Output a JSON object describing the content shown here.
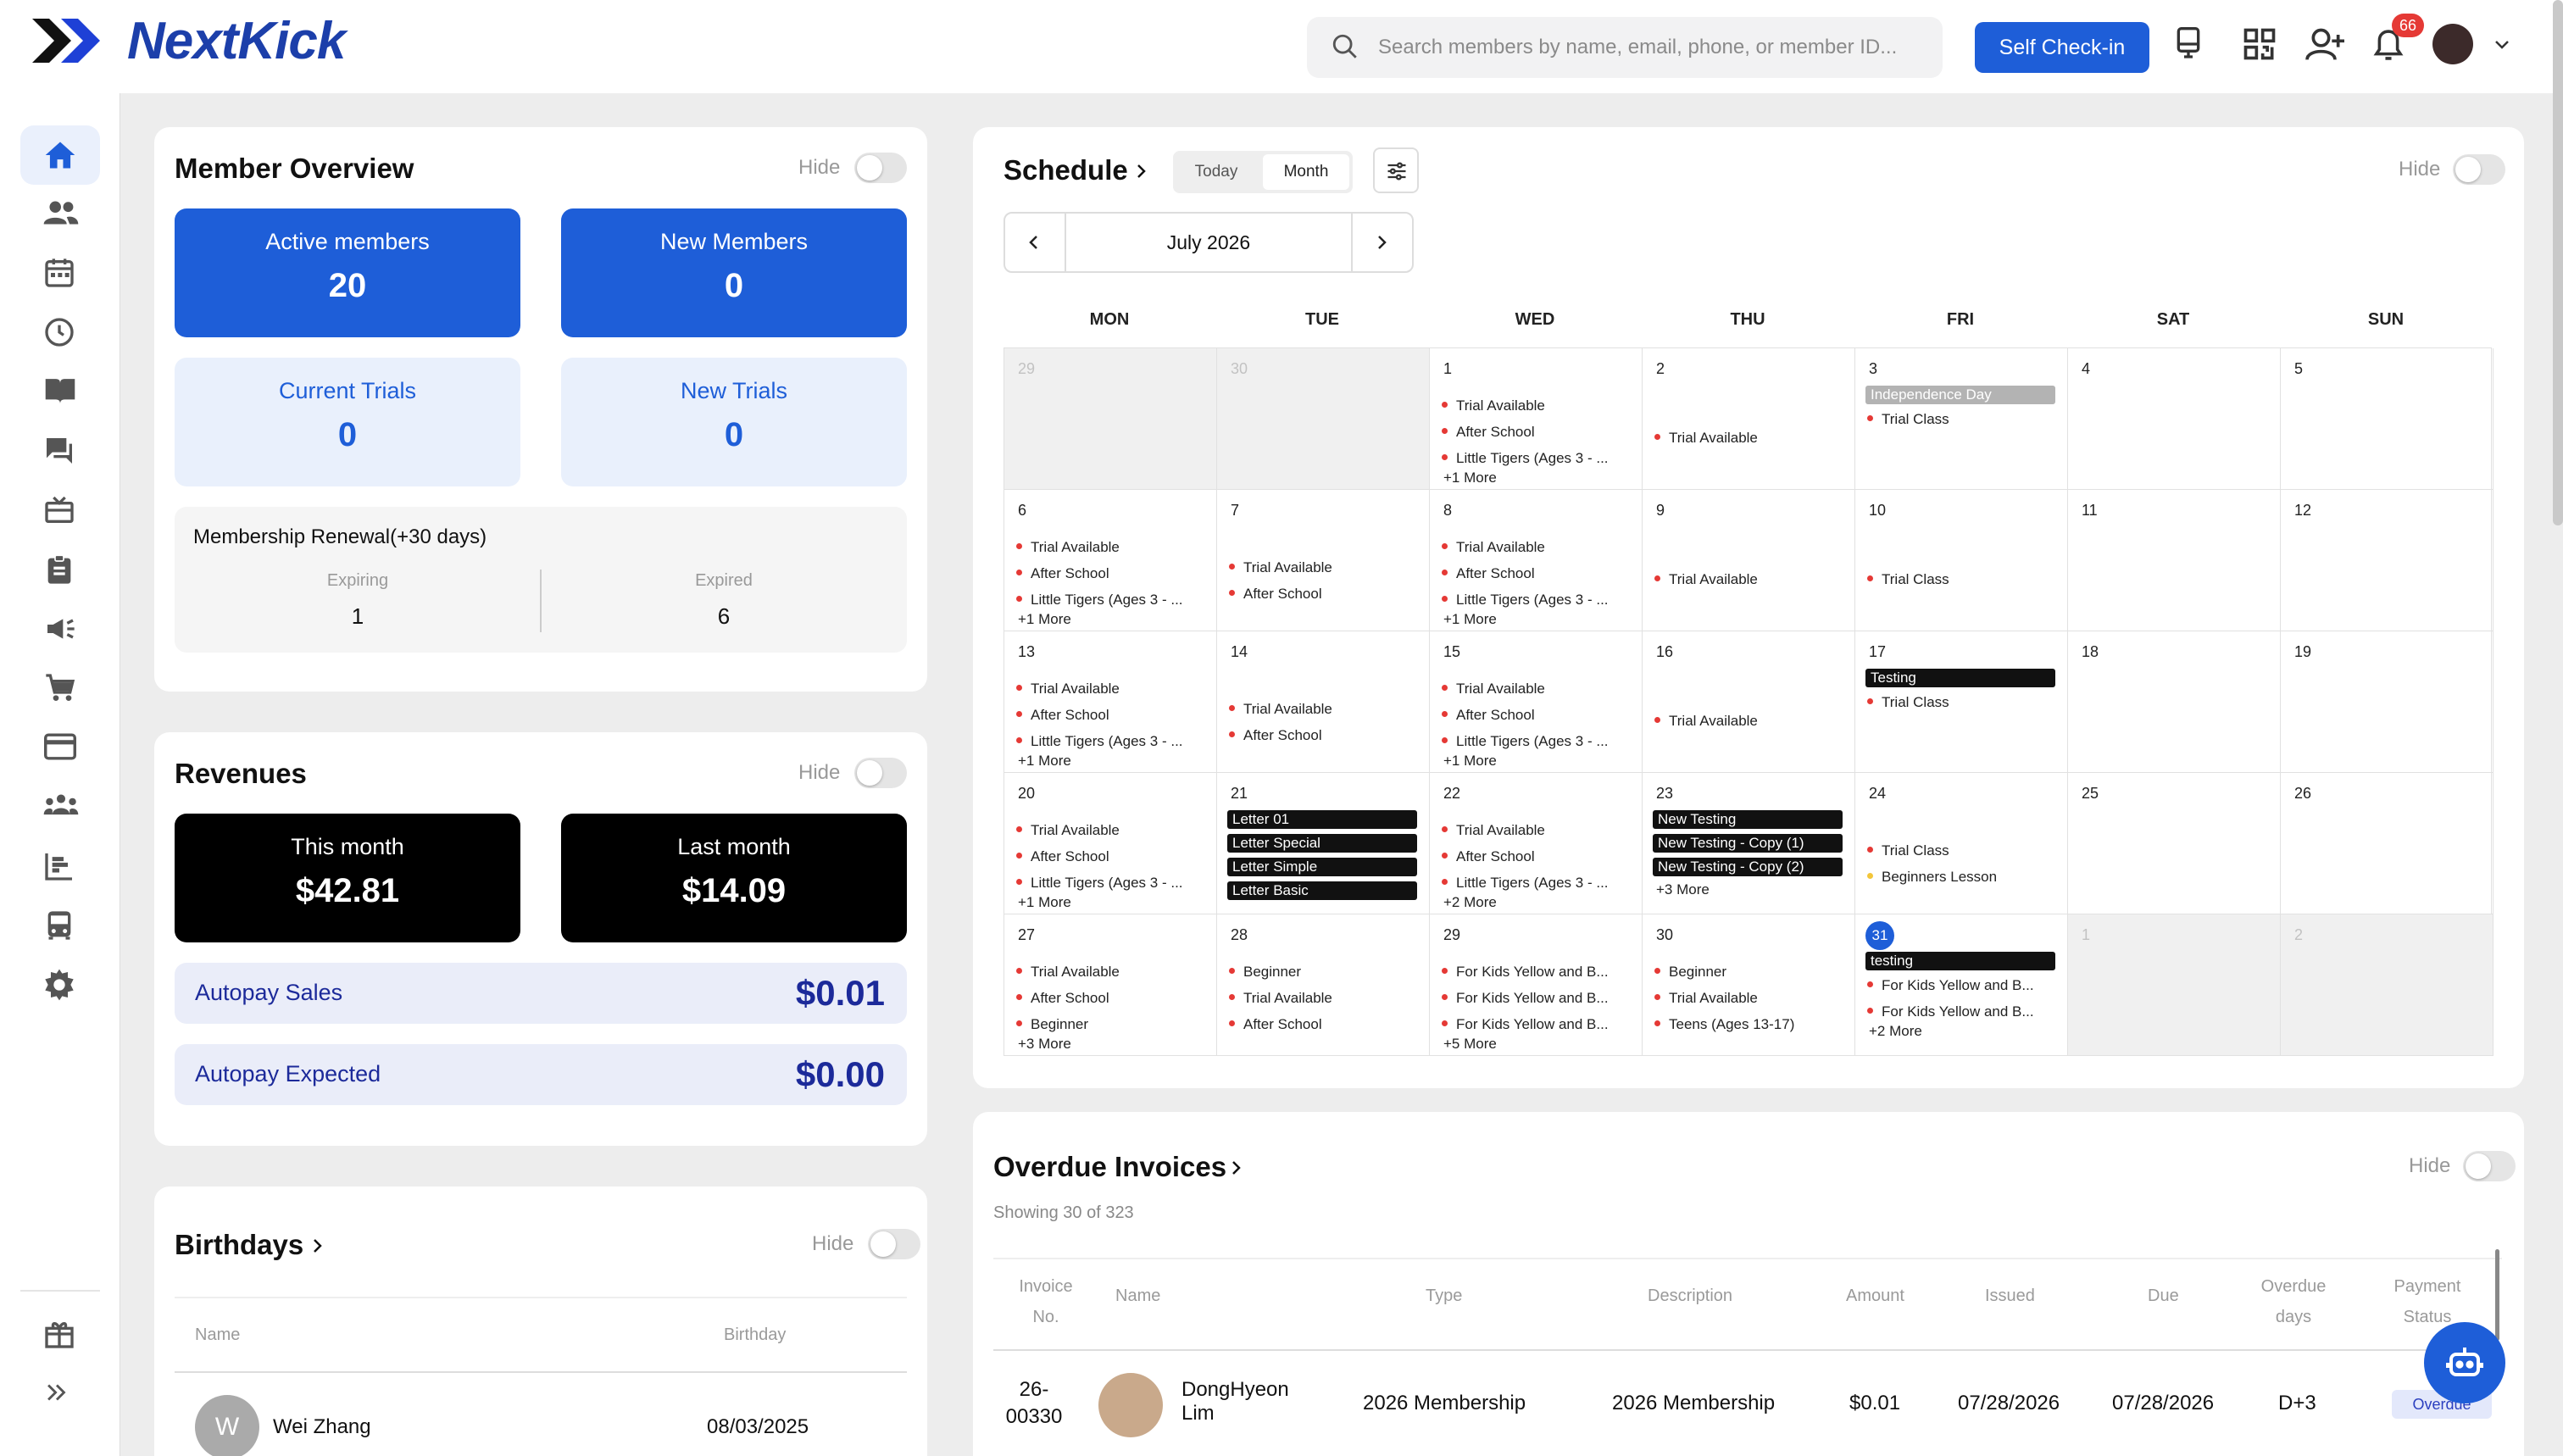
{
  "app": {
    "brand": "NextKick"
  },
  "header": {
    "search_placeholder": "Search members by name, email, phone, or member ID...",
    "checkin_label": "Self Check-in",
    "notification_count": "66"
  },
  "member_overview": {
    "title": "Member Overview",
    "hide_label": "Hide",
    "stats": [
      {
        "label": "Active members",
        "value": "20"
      },
      {
        "label": "New Members",
        "value": "0"
      },
      {
        "label": "Current Trials",
        "value": "0"
      },
      {
        "label": "New Trials",
        "value": "0"
      }
    ],
    "renewal": {
      "title": "Membership Renewal(+30 days)",
      "expiring_label": "Expiring",
      "expiring_value": "1",
      "expired_label": "Expired",
      "expired_value": "6"
    }
  },
  "revenues": {
    "title": "Revenues",
    "hide_label": "Hide",
    "this_month_label": "This month",
    "this_month_value": "$42.81",
    "last_month_label": "Last month",
    "last_month_value": "$14.09",
    "autopay_sales_label": "Autopay Sales",
    "autopay_sales_value": "$0.01",
    "autopay_expected_label": "Autopay Expected",
    "autopay_expected_value": "$0.00"
  },
  "birthdays": {
    "title": "Birthdays",
    "hide_label": "Hide",
    "col_name": "Name",
    "col_birthday": "Birthday",
    "rows": [
      {
        "initial": "W",
        "name": "Wei Zhang",
        "birthday": "08/03/2025"
      }
    ]
  },
  "schedule": {
    "title": "Schedule",
    "hide_label": "Hide",
    "today_label": "Today",
    "month_label": "Month",
    "month_title": "July 2026",
    "weekdays": [
      "MON",
      "TUE",
      "WED",
      "THU",
      "FRI",
      "SAT",
      "SUN"
    ],
    "weeks": [
      [
        {
          "day": "29",
          "gray": true,
          "events": []
        },
        {
          "day": "30",
          "gray": true,
          "events": []
        },
        {
          "day": "1",
          "events": [
            [
              "Trial Available",
              "r"
            ],
            [
              "After School",
              "r"
            ],
            [
              "Little Tigers (Ages 3 - ...",
              "r"
            ]
          ],
          "more": "+1 More"
        },
        {
          "day": "2",
          "events": [
            [
              "Trial Available",
              "r"
            ]
          ],
          "center": true
        },
        {
          "day": "3",
          "tags": [
            [
              "Independence Day",
              "grey"
            ]
          ],
          "events": [
            [
              "Trial Class",
              "r"
            ]
          ]
        },
        {
          "day": "4",
          "events": []
        },
        {
          "day": "5",
          "events": []
        }
      ],
      [
        {
          "day": "6",
          "events": [
            [
              "Trial Available",
              "r"
            ],
            [
              "After School",
              "r"
            ],
            [
              "Little Tigers (Ages 3 - ...",
              "r"
            ]
          ],
          "more": "+1 More"
        },
        {
          "day": "7",
          "events": [
            [
              "Trial Available",
              "r"
            ],
            [
              "After School",
              "r"
            ]
          ],
          "center": true
        },
        {
          "day": "8",
          "events": [
            [
              "Trial Available",
              "r"
            ],
            [
              "After School",
              "r"
            ],
            [
              "Little Tigers (Ages 3 - ...",
              "r"
            ]
          ],
          "more": "+1 More"
        },
        {
          "day": "9",
          "events": [
            [
              "Trial Available",
              "r"
            ]
          ],
          "center": true
        },
        {
          "day": "10",
          "events": [
            [
              "Trial Class",
              "r"
            ]
          ],
          "center": true
        },
        {
          "day": "11",
          "events": []
        },
        {
          "day": "12",
          "events": []
        }
      ],
      [
        {
          "day": "13",
          "events": [
            [
              "Trial Available",
              "r"
            ],
            [
              "After School",
              "r"
            ],
            [
              "Little Tigers (Ages 3 - ...",
              "r"
            ]
          ],
          "more": "+1 More"
        },
        {
          "day": "14",
          "events": [
            [
              "Trial Available",
              "r"
            ],
            [
              "After School",
              "r"
            ]
          ],
          "center": true
        },
        {
          "day": "15",
          "events": [
            [
              "Trial Available",
              "r"
            ],
            [
              "After School",
              "r"
            ],
            [
              "Little Tigers (Ages 3 - ...",
              "r"
            ]
          ],
          "more": "+1 More"
        },
        {
          "day": "16",
          "events": [
            [
              "Trial Available",
              "r"
            ]
          ],
          "center": true
        },
        {
          "day": "17",
          "tags": [
            [
              "Testing",
              "black"
            ]
          ],
          "events": [
            [
              "Trial Class",
              "r"
            ]
          ]
        },
        {
          "day": "18",
          "events": []
        },
        {
          "day": "19",
          "events": []
        }
      ],
      [
        {
          "day": "20",
          "events": [
            [
              "Trial Available",
              "r"
            ],
            [
              "After School",
              "r"
            ],
            [
              "Little Tigers (Ages 3 - ...",
              "r"
            ]
          ],
          "more": "+1 More"
        },
        {
          "day": "21",
          "tags": [
            [
              "Letter 01",
              "black"
            ],
            [
              "Letter Special",
              "black"
            ],
            [
              "Letter Simple",
              "black"
            ],
            [
              "Letter Basic",
              "black"
            ]
          ],
          "events": []
        },
        {
          "day": "22",
          "events": [
            [
              "Trial Available",
              "r"
            ],
            [
              "After School",
              "r"
            ],
            [
              "Little Tigers (Ages 3 - ...",
              "r"
            ]
          ],
          "more": "+2 More"
        },
        {
          "day": "23",
          "tags": [
            [
              "New Testing",
              "black"
            ],
            [
              "New Testing - Copy (1)",
              "black"
            ],
            [
              "New Testing - Copy (2)",
              "black"
            ]
          ],
          "events": [],
          "more": "+3 More"
        },
        {
          "day": "24",
          "events": [
            [
              "Trial Class",
              "r"
            ],
            [
              "Beginners Lesson",
              "y"
            ]
          ],
          "center": true
        },
        {
          "day": "25",
          "events": []
        },
        {
          "day": "26",
          "events": []
        }
      ],
      [
        {
          "day": "27",
          "events": [
            [
              "Trial Available",
              "r"
            ],
            [
              "After School",
              "r"
            ],
            [
              "Beginner",
              "r"
            ]
          ],
          "more": "+3 More"
        },
        {
          "day": "28",
          "events": [
            [
              "Beginner",
              "r"
            ],
            [
              "Trial Available",
              "r"
            ],
            [
              "After School",
              "r"
            ]
          ]
        },
        {
          "day": "29",
          "events": [
            [
              "For Kids Yellow and B...",
              "r"
            ],
            [
              "For Kids Yellow and B...",
              "r"
            ],
            [
              "For Kids Yellow and B...",
              "r"
            ]
          ],
          "more": "+5 More"
        },
        {
          "day": "30",
          "events": [
            [
              "Beginner",
              "r"
            ],
            [
              "Trial Available",
              "r"
            ],
            [
              "Teens (Ages 13-17)",
              "r"
            ]
          ]
        },
        {
          "day": "31",
          "today": true,
          "tags": [
            [
              "testing",
              "black"
            ]
          ],
          "events": [
            [
              "For Kids Yellow and B...",
              "r"
            ],
            [
              "For Kids Yellow and B...",
              "r"
            ]
          ],
          "more": "+2 More"
        },
        {
          "day": "1",
          "gray": true,
          "events": []
        },
        {
          "day": "2",
          "gray": true,
          "events": []
        }
      ]
    ]
  },
  "invoices": {
    "title": "Overdue Invoices",
    "hide_label": "Hide",
    "showing": "Showing 30 of 323",
    "columns": {
      "invoice_no_1": "Invoice",
      "invoice_no_2": "No.",
      "name": "Name",
      "type": "Type",
      "description": "Description",
      "amount": "Amount",
      "issued": "Issued",
      "due": "Due",
      "overdue_1": "Overdue",
      "overdue_2": "days",
      "status_1": "Payment",
      "status_2": "Status"
    },
    "rows": [
      {
        "no_1": "26-",
        "no_2": "00330",
        "name_1": "DongHyeon",
        "name_2": "Lim",
        "type": "2026 Membership",
        "description": "2026 Membership",
        "amount": "$0.01",
        "issued": "07/28/2026",
        "due": "07/28/2026",
        "overdue_days": "D+3",
        "status": "Overdue"
      }
    ]
  },
  "colors": {
    "primary": "#1e5ed8",
    "brand": "#1c3faa",
    "event_dot": "#e53935",
    "event_dot_alt": "#f3c63a"
  }
}
